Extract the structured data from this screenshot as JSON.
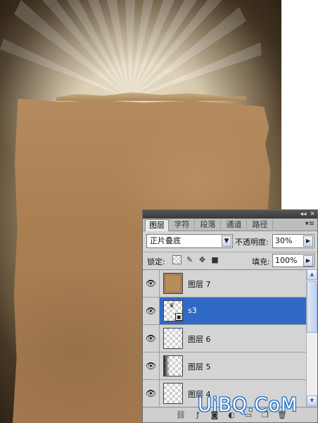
{
  "panel": {
    "title_controls": [
      "◂◂",
      "✕"
    ],
    "tabs": [
      {
        "label": "图层",
        "active": true
      },
      {
        "label": "字符",
        "active": false
      },
      {
        "label": "段落",
        "active": false
      },
      {
        "label": "通道",
        "active": false
      },
      {
        "label": "路径",
        "active": false
      }
    ],
    "menu_icon": "panel-menu-icon",
    "blend_mode": "正片叠底",
    "opacity_label": "不透明度:",
    "opacity_value": "30%",
    "lock_label": "锁定:",
    "fill_label": "填充:",
    "fill_value": "100%",
    "layers": [
      {
        "name": "图层 7",
        "visible": true,
        "selected": false,
        "thumb": "paper"
      },
      {
        "name": "s3",
        "visible": true,
        "selected": true,
        "thumb": "smart-object"
      },
      {
        "name": "图层 6",
        "visible": true,
        "selected": false,
        "thumb": "transparent"
      },
      {
        "name": "图层 5",
        "visible": true,
        "selected": false,
        "thumb": "dark-edge"
      },
      {
        "name": "图层 4",
        "visible": true,
        "selected": false,
        "thumb": "transparent"
      }
    ],
    "bottom_icons": [
      "link-layers-icon",
      "layer-style-icon",
      "layer-mask-icon",
      "adjustment-layer-icon",
      "new-group-icon",
      "new-layer-icon",
      "delete-layer-icon"
    ]
  },
  "watermark": "UiBQ.CoM",
  "colors": {
    "selection": "#3169c6",
    "panel_bg": "#d4d4d4",
    "watermark_outline": "#0a63c8"
  }
}
